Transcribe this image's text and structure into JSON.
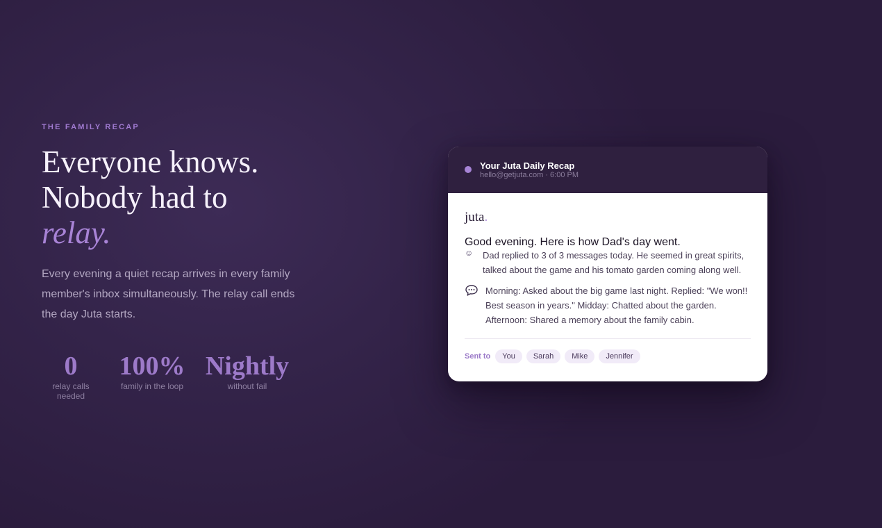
{
  "hero": {
    "eyebrow": "THE FAMILY RECAP",
    "headline_line1": "Everyone knows.",
    "headline_line2": "Nobody had to",
    "headline_accent": "relay.",
    "lede": "Every evening a quiet recap arrives in every family member's inbox simultaneously. The relay call ends the day Juta starts."
  },
  "stats": [
    {
      "value": "0",
      "label": "relay calls needed"
    },
    {
      "value": "100%",
      "label": "family in the loop"
    },
    {
      "value": "Nightly",
      "label": "without fail"
    }
  ],
  "email": {
    "title": "Your Juta Daily Recap",
    "meta": "hello@getjuta.com · 6:00 PM",
    "brand_name": "juta",
    "brand_dot": ".",
    "greeting": "Good evening. Here is how Dad's day went.",
    "summary": "Dad replied to 3 of 3 messages today. He seemed in great spirits, talked about the game and his tomato garden coming along well.",
    "details": "Morning: Asked about the big game last night. Replied: \"We won!! Best season in years.\" Midday: Chatted about the garden. Afternoon: Shared a memory about the family cabin.",
    "summary_icon": "smiley-icon",
    "details_icon": "speech-bubble-icon",
    "sent_to_label": "Sent to",
    "recipients": [
      "You",
      "Sarah",
      "Mike",
      "Jennifer"
    ]
  },
  "colors": {
    "background": "#2d1f3f",
    "accent": "#a784d6",
    "card_header": "#2f203f"
  }
}
